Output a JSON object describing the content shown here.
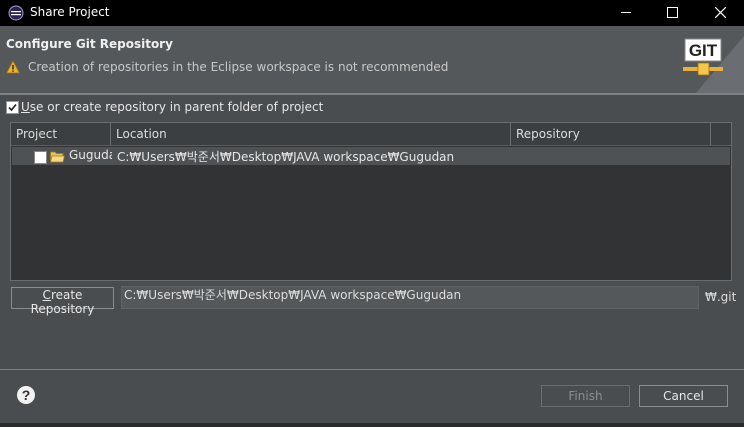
{
  "window": {
    "title": "Share Project",
    "icon": "eclipse-icon"
  },
  "header": {
    "title": "Configure Git Repository",
    "warning": "Creation of repositories in the Eclipse workspace is not recommended",
    "banner_text": "GIT"
  },
  "options": {
    "use_parent_label": "Use or create repository in parent folder of project",
    "use_parent_checked": true
  },
  "table": {
    "columns": [
      "Project",
      "Location",
      "Repository"
    ],
    "rows": [
      {
        "project": "Guguda",
        "location": "C:₩Users₩박준서₩Desktop₩JAVA workspace₩Gugudan",
        "repository": "",
        "checked": false
      }
    ]
  },
  "create_repo": {
    "button_label": "Create Repository",
    "path": "C:₩Users₩박준서₩Desktop₩JAVA workspace₩Gugudan",
    "suffix": "₩.git"
  },
  "footer": {
    "finish_label": "Finish",
    "cancel_label": "Cancel",
    "finish_enabled": false
  },
  "colors": {
    "accent_warning": "#e8b13a",
    "git_banner_bg": "#ffffff",
    "git_letters": "#222222"
  }
}
